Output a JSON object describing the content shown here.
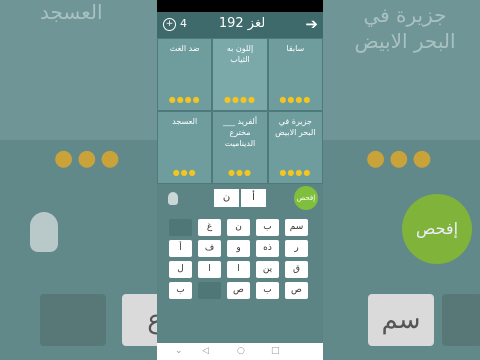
{
  "header": {
    "title": "لغز 192",
    "coins": "4",
    "coin_glyph": "+",
    "forward_arrow": "➔"
  },
  "clues": [
    {
      "text": "سابقا"
    },
    {
      "text": "إللون به الثياب"
    },
    {
      "text": "ضد الغث"
    },
    {
      "text": "جزيرة في البحر الابيض"
    },
    {
      "text": "ألفريد ___ مخترع الديناميت"
    },
    {
      "text": "العسجد"
    }
  ],
  "answer_slots": [
    "أ",
    "ن"
  ],
  "check_label": "إفحص",
  "keyboard": [
    [
      "سم",
      "ب",
      "ن",
      "غ",
      ""
    ],
    [
      "ر",
      "ذه",
      "و",
      "ف",
      "أ"
    ],
    [
      "ق",
      "ين",
      "ا",
      "ا",
      "ل"
    ],
    [
      "ص",
      "ب",
      "ص",
      "",
      "ب"
    ]
  ],
  "nav": {
    "down": "⌄",
    "back": "◁",
    "home": "○",
    "recent": "□"
  },
  "background": {
    "left_text": "العسجد",
    "right_text": "جزيرة في البحر الابيض",
    "check_label": "إفحص",
    "keys": [
      "سم",
      "ب",
      "ع"
    ]
  },
  "colors": {
    "topbar": "#3f6a6c",
    "cell": "#6f9d9e",
    "check": "#7fbf3b",
    "dots": "#f2c521"
  }
}
